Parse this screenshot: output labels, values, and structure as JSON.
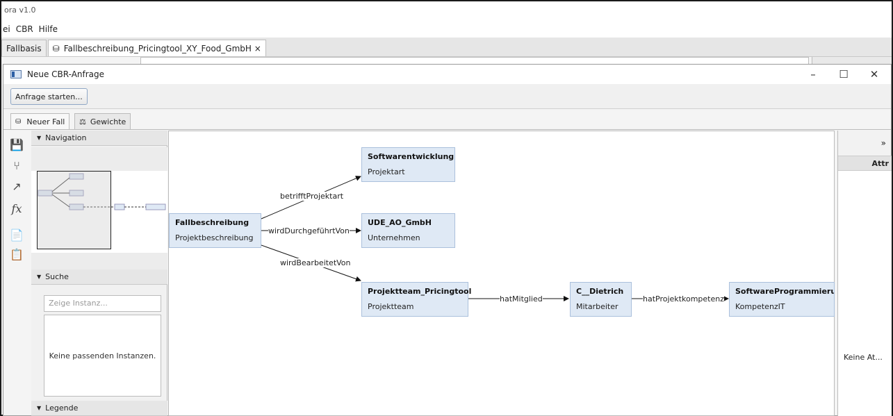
{
  "app": {
    "title": "ora v1.0"
  },
  "menu": {
    "items": [
      "ei",
      "CBR",
      "Hilfe"
    ]
  },
  "tabs": {
    "items": [
      "Fallbasis",
      "Fallbeschreibung_Pricingtool_XY_Food_GmbH ×"
    ]
  },
  "dialog": {
    "title": "Neue CBR-Anfrage",
    "minimize": "–",
    "maximize": "☐",
    "close": "✕",
    "start_button": "Anfrage starten...",
    "subtabs": [
      "Neuer Fall",
      "Gewichte"
    ]
  },
  "navigation": {
    "header": "Navigation"
  },
  "search": {
    "header": "Suche",
    "placeholder": "Zeige Instanz...",
    "empty": "Keine passenden Instanzen."
  },
  "legend": {
    "header": "Legende"
  },
  "rightpanel": {
    "expand": "»",
    "header": "Attr",
    "empty": "Keine At..."
  },
  "graph": {
    "nodes": {
      "fallbeschreibung": {
        "title": "Fallbeschreibung",
        "type": "Projektbeschreibung"
      },
      "softwareentwicklung": {
        "title": "Softwarentwicklung",
        "type": "Projektart"
      },
      "ude": {
        "title": "UDE_AO_GmbH",
        "type": "Unternehmen"
      },
      "projektteam": {
        "title": "Projektteam_Pricingtool",
        "type": "Projektteam"
      },
      "dietrich": {
        "title": "C__Dietrich",
        "type": "Mitarbeiter"
      },
      "softwareprog": {
        "title": "SoftwareProgrammierun",
        "type": "KompetenzIT"
      }
    },
    "edges": {
      "betrifft": "betrifftProjektart",
      "durchgefuehrt": "wirdDurchgeführtVon",
      "bearbeitet": "wirdBearbeitetVon",
      "mitglied": "hatMitglied",
      "kompetenz": "hatProjektkompetenz"
    }
  }
}
